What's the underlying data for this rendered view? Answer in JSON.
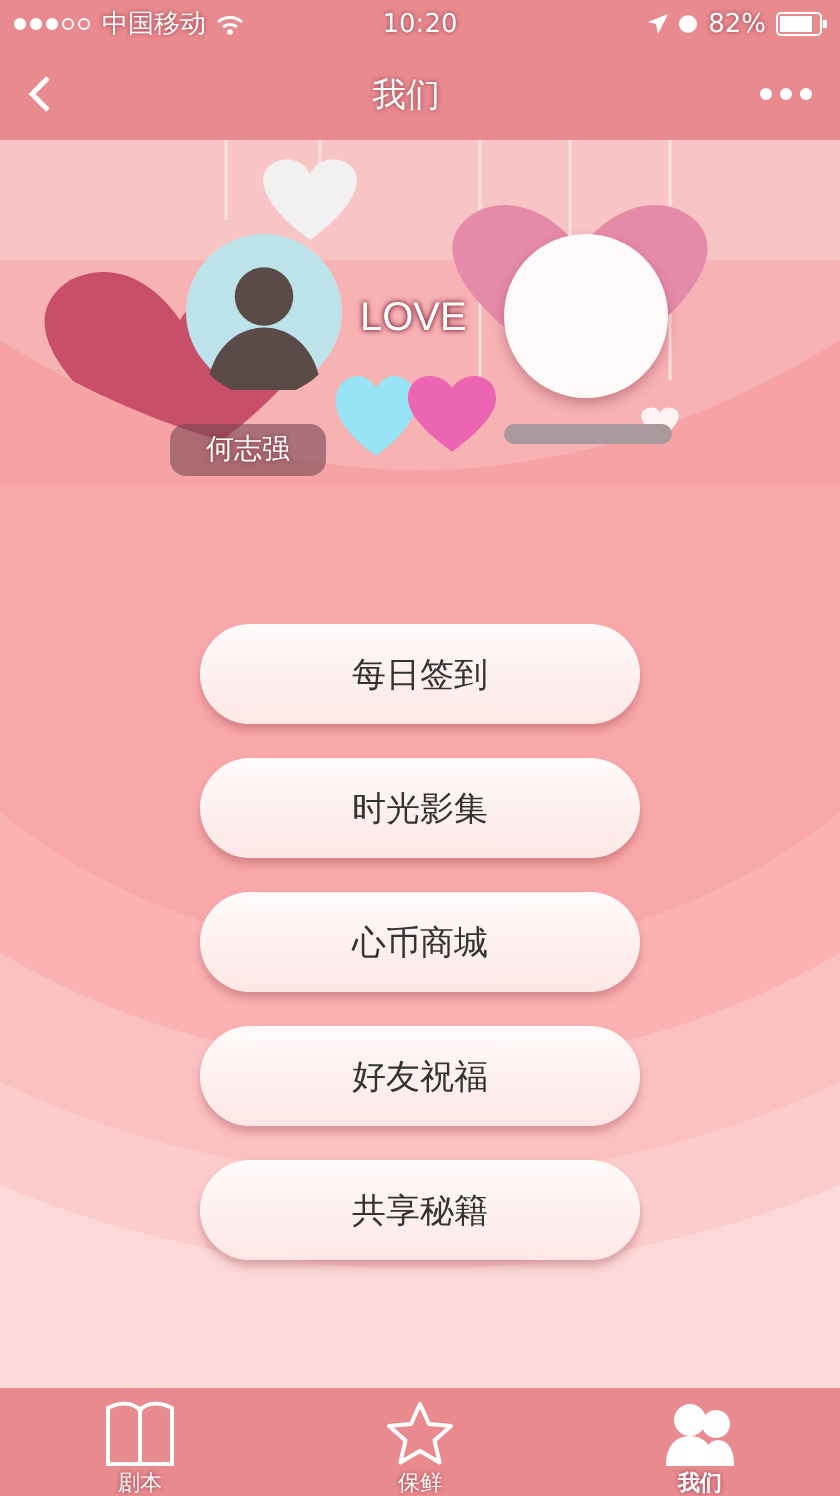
{
  "status_bar": {
    "carrier": "中国移动",
    "time": "10:20",
    "battery": "82%"
  },
  "nav": {
    "title": "我们"
  },
  "profile": {
    "name": "何志强",
    "love": "LOVE"
  },
  "menu": [
    "每日签到",
    "时光影集",
    "心币商城",
    "好友祝福",
    "共享秘籍"
  ],
  "tabs": [
    {
      "label": "剧本",
      "kind": "book",
      "selected": false
    },
    {
      "label": "保鲜",
      "kind": "star",
      "selected": false
    },
    {
      "label": "我们",
      "kind": "people",
      "selected": true
    }
  ]
}
